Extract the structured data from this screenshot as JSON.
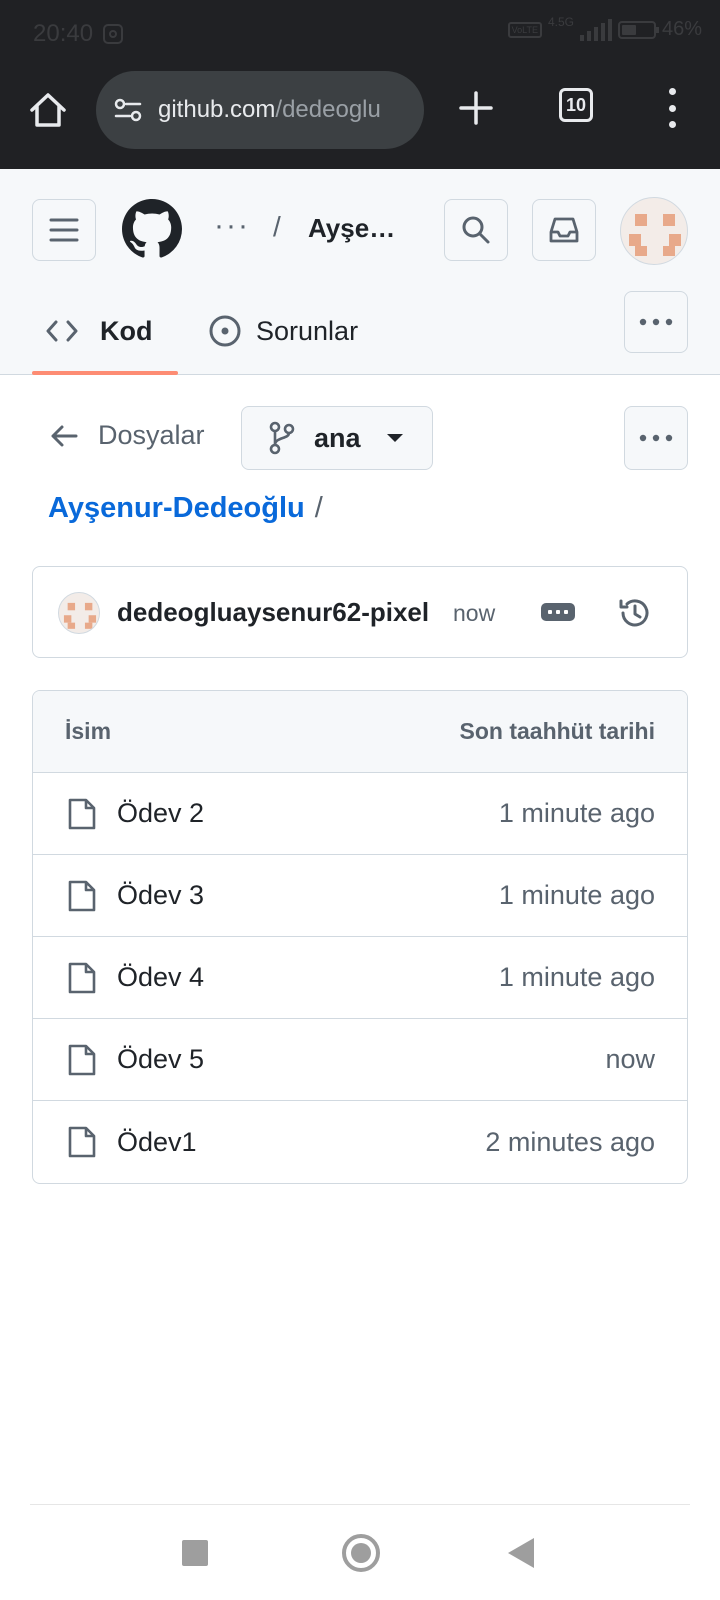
{
  "status_bar": {
    "time": "20:40",
    "network": "4.5G",
    "battery": "46%"
  },
  "browser": {
    "url_host": "github.com",
    "url_path": "/dedeoglu",
    "tab_count": "10"
  },
  "header": {
    "breadcrumb_dots": "···",
    "breadcrumb_sep": "/",
    "repo_name": "Ayşenur-Dedeoğlu"
  },
  "tabs": [
    {
      "label": "Kod",
      "icon": "code-icon",
      "selected": true
    },
    {
      "label": "Sorunlar",
      "icon": "issue-opened-icon",
      "selected": false
    }
  ],
  "nav": {
    "back_label": "Dosyalar",
    "branch": "ana"
  },
  "path": {
    "folder": "Ayşenur-Dedeoğlu",
    "separator": "/"
  },
  "commit": {
    "author": "dedeogluaysenur62-pixel",
    "time": "now"
  },
  "file_table": {
    "col_name": "İsim",
    "col_date": "Son taahhüt tarihi",
    "rows": [
      {
        "name": "Ödev 2",
        "date": "1 minute ago"
      },
      {
        "name": "Ödev 3",
        "date": "1 minute ago"
      },
      {
        "name": "Ödev 4",
        "date": "1 minute ago"
      },
      {
        "name": "Ödev 5",
        "date": "now"
      },
      {
        "name": "Ödev1",
        "date": "2 minutes ago"
      }
    ]
  },
  "colors": {
    "link": "#0969da",
    "tab_underline": "#fd8c73",
    "chrome_bg": "#202124",
    "avatar_accent": "#e8a98a"
  }
}
